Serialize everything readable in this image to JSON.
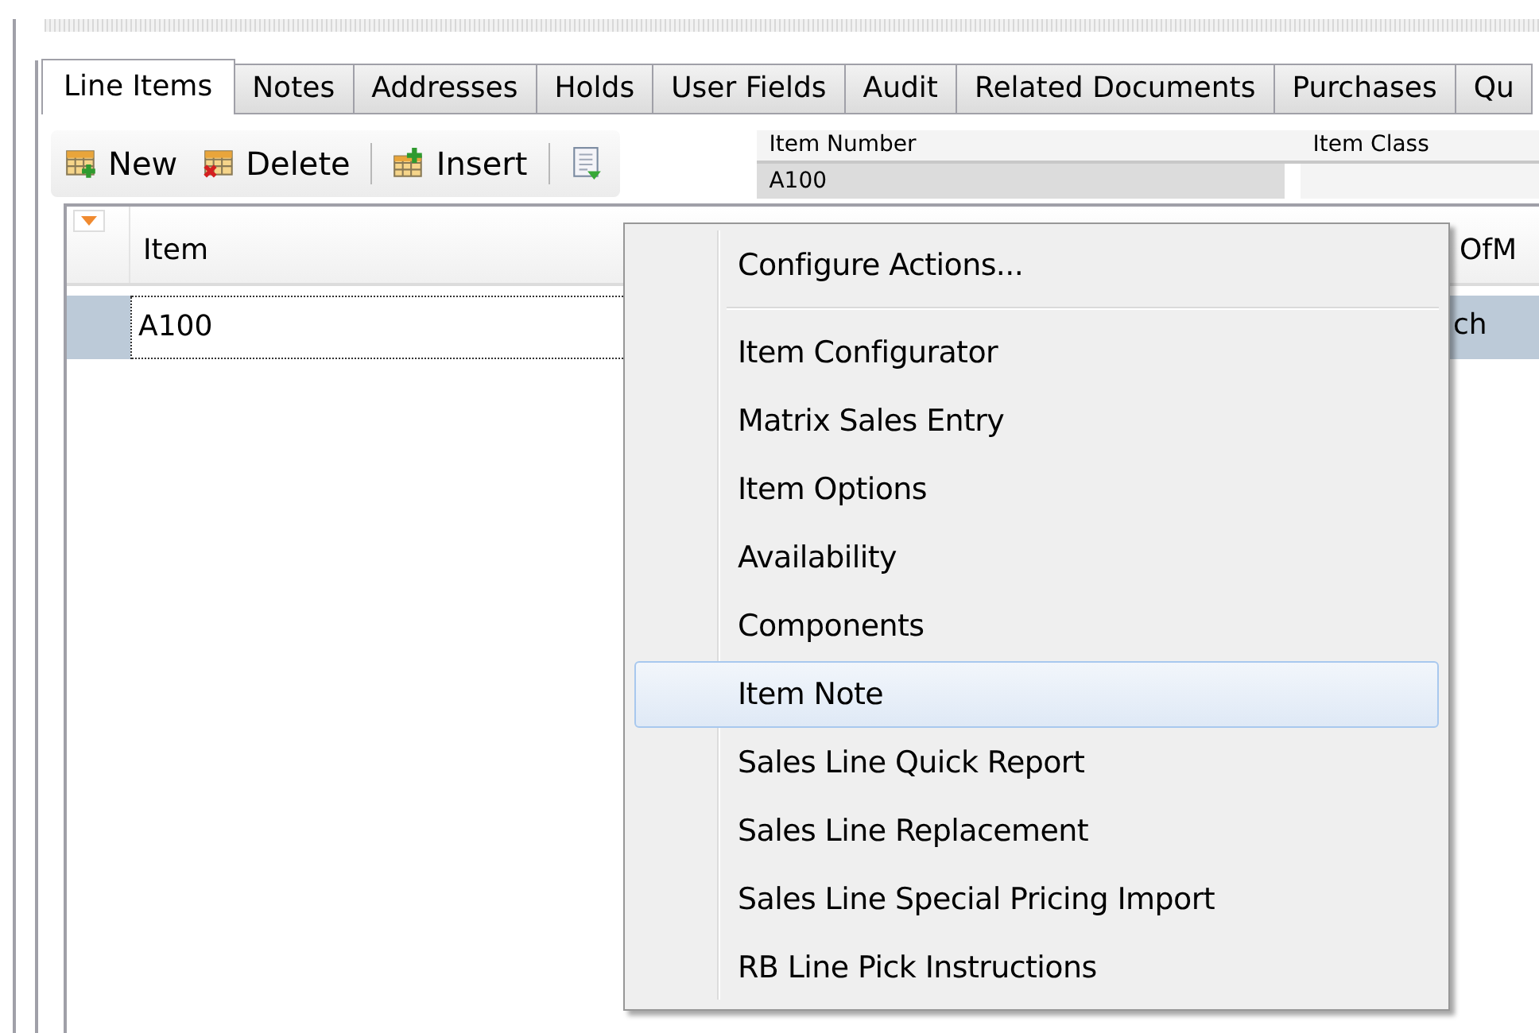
{
  "tabs": [
    {
      "label": "Line Items",
      "selected": true
    },
    {
      "label": "Notes",
      "selected": false
    },
    {
      "label": "Addresses",
      "selected": false
    },
    {
      "label": "Holds",
      "selected": false
    },
    {
      "label": "User Fields",
      "selected": false
    },
    {
      "label": "Audit",
      "selected": false
    },
    {
      "label": "Related Documents",
      "selected": false
    },
    {
      "label": "Purchases",
      "selected": false
    },
    {
      "label": "Qu",
      "selected": false
    }
  ],
  "toolbar": {
    "buttons": [
      {
        "kind": "new",
        "label": "New"
      },
      {
        "kind": "delete",
        "label": "Delete"
      },
      {
        "kind": "insert",
        "label": "Insert"
      },
      {
        "kind": "actions"
      }
    ]
  },
  "fields": [
    {
      "label": "Item Number",
      "value": "A100"
    },
    {
      "label": "Item Class"
    }
  ],
  "grid": {
    "columns": [
      "Item",
      "OfM"
    ],
    "rows": [
      {
        "selected": true,
        "cells": [
          "A100",
          "ch"
        ]
      }
    ]
  },
  "context_menu": {
    "items": [
      {
        "kind": "item",
        "label": "Configure Actions...",
        "selected": false
      },
      {
        "kind": "separator"
      },
      {
        "kind": "item",
        "label": "Item Configurator",
        "selected": false
      },
      {
        "kind": "item",
        "label": "Matrix Sales Entry",
        "selected": false
      },
      {
        "kind": "item",
        "label": "Item Options",
        "selected": false
      },
      {
        "kind": "item",
        "label": "Availability",
        "selected": false
      },
      {
        "kind": "item",
        "label": "Components",
        "selected": false
      },
      {
        "kind": "item",
        "label": "Item Note",
        "selected": true
      },
      {
        "kind": "item",
        "label": "Sales Line Quick Report",
        "selected": false
      },
      {
        "kind": "item",
        "label": "Sales Line Replacement",
        "selected": false
      },
      {
        "kind": "item",
        "label": "Sales Line Special Pricing Import",
        "selected": false
      },
      {
        "kind": "item",
        "label": "RB Line Pick Instructions",
        "selected": false
      }
    ]
  }
}
